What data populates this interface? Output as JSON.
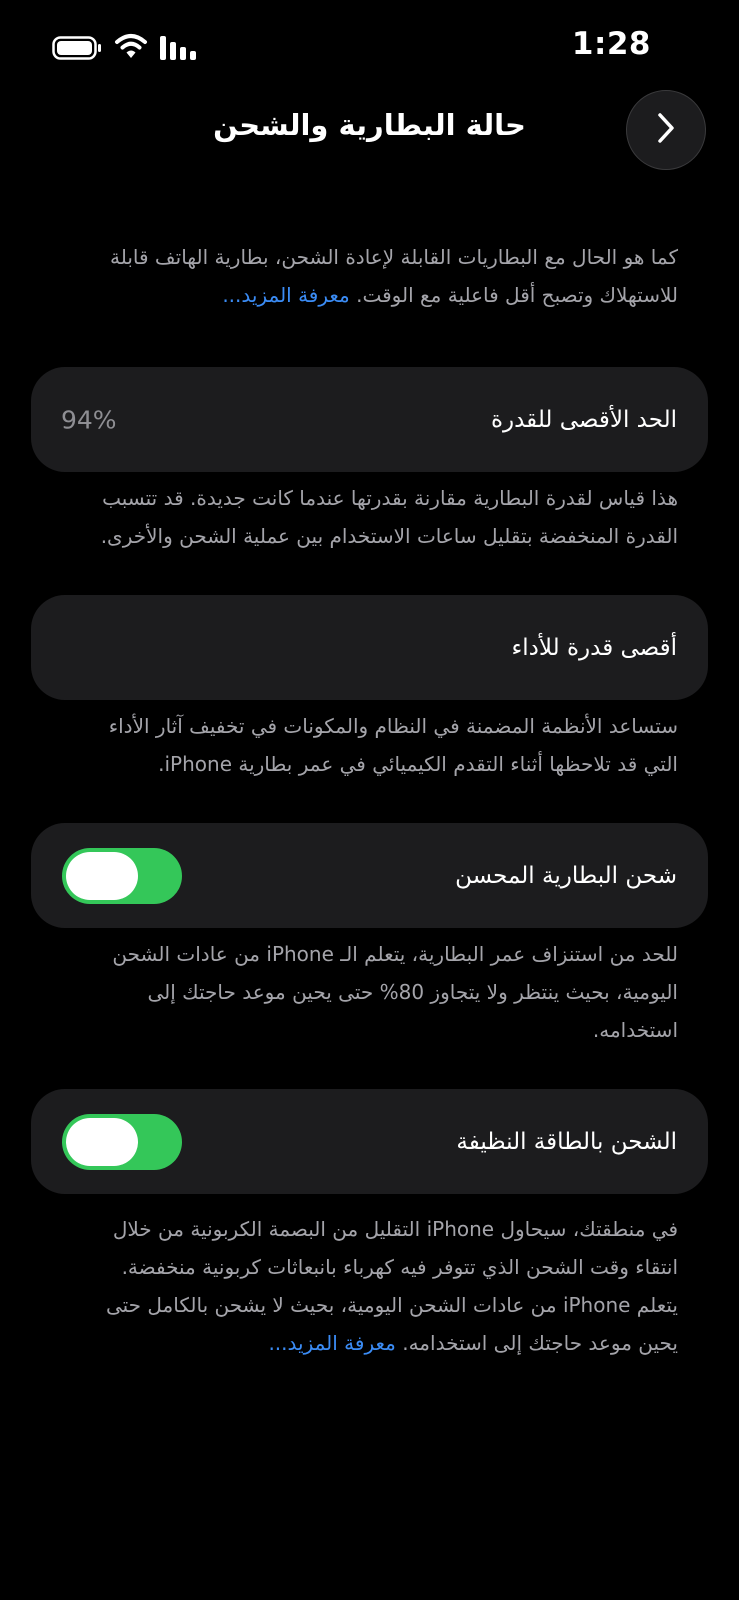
{
  "status_bar": {
    "time": "1:28"
  },
  "header": {
    "title": "حالة البطارية والشحن"
  },
  "intro": {
    "line1": "كما هو الحال مع البطاريات القابلة لإعادة الشحن، بطارية الهاتف قابلة",
    "line2_text": "للاستهلاك وتصبح أقل فاعلية مع الوقت.",
    "line2_link": "معرفة المزيد..."
  },
  "max_capacity": {
    "label": "الحد الأقصى للقدرة",
    "value": "94%",
    "desc_line1": "هذا قياس لقدرة البطارية مقارنة بقدرتها عندما كانت جديدة. قد تتسبب",
    "desc_line2": "القدرة المنخفضة بتقليل ساعات الاستخدام بين عملية الشحن والأخرى."
  },
  "peak_performance": {
    "label": "أقصى قدرة للأداء",
    "desc_line1": "ستساعد الأنظمة المضمنة في النظام والمكونات في تخفيف آثار الأداء",
    "desc_line2": "التي قد تلاحظها أثناء التقدم الكيميائي في عمر بطارية iPhone."
  },
  "optimized_charging": {
    "label": "شحن البطارية المحسن",
    "enabled": true,
    "desc_line1": "للحد من استنزاف عمر البطارية، يتعلم الـ iPhone من عادات الشحن",
    "desc_line2": "اليومية، بحيث ينتظر ولا يتجاوز 80% حتى يحين موعد حاجتك إلى",
    "desc_line3": "استخدامه."
  },
  "clean_energy": {
    "label": "الشحن بالطاقة النظيفة",
    "enabled": true,
    "desc_line1": "في منطقتك، سيحاول iPhone التقليل من البصمة الكربونية من خلال",
    "desc_line2": "انتقاء وقت الشحن الذي تتوفر فيه كهرباء بانبعاثات كربونية منخفضة.",
    "desc_line3": "يتعلم iPhone من عادات الشحن اليومية، بحيث لا يشحن بالكامل حتى",
    "desc_line4_text": "يحين موعد حاجتك إلى استخدامه.",
    "desc_line4_link": "معرفة المزيد..."
  },
  "colors": {
    "background": "#000000",
    "card": "#1c1c1e",
    "secondary_text": "#a4a4aa",
    "link": "#3b8cf5",
    "toggle_on": "#34c759"
  }
}
